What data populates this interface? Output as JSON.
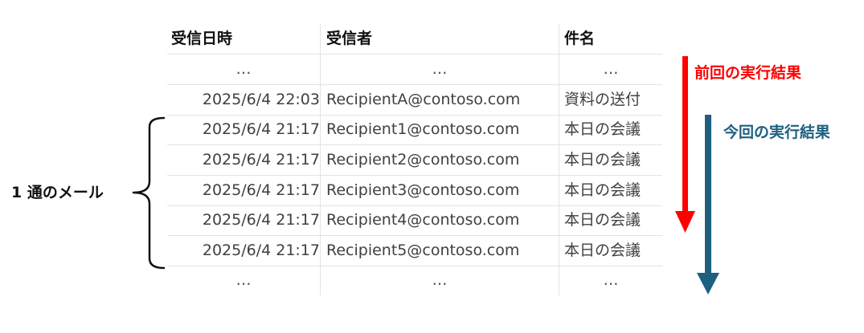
{
  "table": {
    "headers": [
      "受信日時",
      "受信者",
      "件名"
    ],
    "rows": [
      [
        "…",
        "…",
        "…"
      ],
      [
        "2025/6/4 22:03",
        "RecipientA@contoso.com",
        "資料の送付"
      ],
      [
        "2025/6/4 21:17",
        "Recipient1@contoso.com",
        "本日の会議"
      ],
      [
        "2025/6/4 21:17",
        "Recipient2@contoso.com",
        "本日の会議"
      ],
      [
        "2025/6/4 21:17",
        "Recipient3@contoso.com",
        "本日の会議"
      ],
      [
        "2025/6/4 21:17",
        "Recipient4@contoso.com",
        "本日の会議"
      ],
      [
        "2025/6/4 21:17",
        "Recipient5@contoso.com",
        "本日の会議"
      ],
      [
        "…",
        "…",
        "…"
      ]
    ]
  },
  "annotations": {
    "brace_label": "1 通のメール",
    "previous_run": "前回の実行結果",
    "current_run": "今回の実行結果"
  },
  "colors": {
    "previous_arrow": "#ff0000",
    "current_arrow": "#1e5f80"
  }
}
